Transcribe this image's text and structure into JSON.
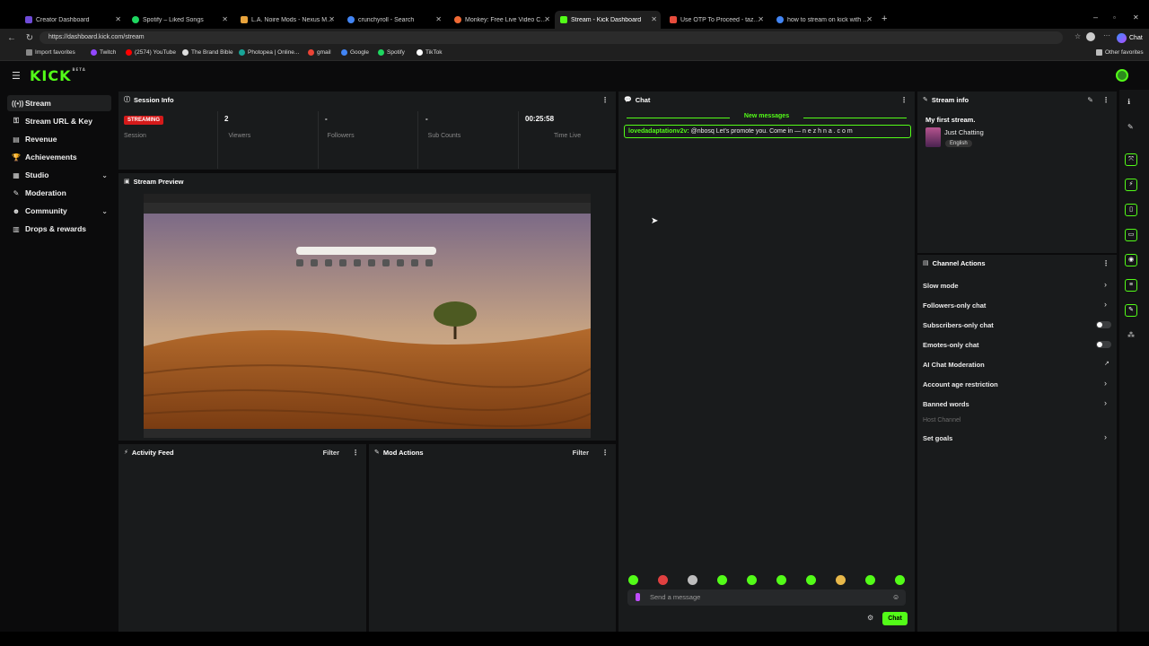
{
  "browser": {
    "tabs": [
      {
        "title": "Creator Dashboard",
        "color": "#6f4bd8"
      },
      {
        "title": "Spotify – Liked Songs",
        "color": "#1ed760"
      },
      {
        "title": "L.A. Noire Mods - Nexus Mods",
        "color": "#e8a33c"
      },
      {
        "title": "crunchyroll - Search",
        "color": "#4285f4"
      },
      {
        "title": "Monkey: Free Live Video Chat",
        "color": "#f06a35"
      },
      {
        "title": "Stream - Kick Dashboard",
        "color": "#53fc18"
      },
      {
        "title": "Use OTP To Proceed - tazwopo@gm",
        "color": "#e74c3c"
      },
      {
        "title": "how to stream on kick with obs - S",
        "color": "#4285f4"
      }
    ],
    "url": "https://dashboard.kick.com/stream",
    "bookmarks": [
      {
        "label": "Import favorites",
        "color": "#888888"
      },
      {
        "label": "Twitch",
        "color": "#9146ff"
      },
      {
        "label": "(2574) YouTube",
        "color": "#ff0000"
      },
      {
        "label": "The Brand Bible",
        "color": "#dddddd"
      },
      {
        "label": "Photopea | Online...",
        "color": "#18a497"
      },
      {
        "label": "gmail",
        "color": "#ea4335"
      },
      {
        "label": "Google",
        "color": "#4285f4"
      },
      {
        "label": "Spotify",
        "color": "#1ed760"
      },
      {
        "label": "TikTok",
        "color": "#ffffff"
      }
    ],
    "other_favorites": "Other favorites",
    "chat_label": "Chat"
  },
  "logo": "KICK",
  "logo_sup": "BETA",
  "sidebar": [
    {
      "label": "Stream",
      "icon": "stream-icon",
      "glyph": "((•))"
    },
    {
      "label": "Stream URL & Key",
      "icon": "key-icon",
      "glyph": "⚿"
    },
    {
      "label": "Revenue",
      "icon": "revenue-icon",
      "glyph": "▤"
    },
    {
      "label": "Achievements",
      "icon": "trophy-icon",
      "glyph": "🏆"
    },
    {
      "label": "Studio",
      "icon": "studio-icon",
      "glyph": "▦"
    },
    {
      "label": "Moderation",
      "icon": "wrench-icon",
      "glyph": "✎"
    },
    {
      "label": "Community",
      "icon": "community-icon",
      "glyph": "☻"
    },
    {
      "label": "Drops & rewards",
      "icon": "drops-icon",
      "glyph": "▥"
    }
  ],
  "session": {
    "title": "Session Info",
    "status": "STREAMING",
    "status_label": "Session",
    "viewers": "2",
    "viewers_label": "Viewers",
    "followers": "-",
    "followers_label": "Followers",
    "subs": "-",
    "subs_label": "Sub Counts",
    "time": "00:25:58",
    "time_label": "Time Live"
  },
  "preview": {
    "title": "Stream Preview"
  },
  "activity": {
    "title": "Activity Feed",
    "filter": "Filter"
  },
  "mod": {
    "title": "Mod Actions",
    "filter": "Filter"
  },
  "chat": {
    "title": "Chat",
    "new_messages": "New messages",
    "message_user": "lovedadaptationv2v:",
    "message_text": "@nbosq Let's promote you. Come in — n e z h n a . c o m",
    "placeholder": "Send a message",
    "send": "Chat"
  },
  "stream_info": {
    "title": "Stream info",
    "stream_title": "My first stream.",
    "category": "Just Chatting",
    "language": "English"
  },
  "channel_actions": {
    "title": "Channel Actions",
    "items": [
      {
        "label": "Slow mode",
        "kind": "chevron"
      },
      {
        "label": "Followers-only chat",
        "kind": "chevron"
      },
      {
        "label": "Subscribers-only chat",
        "kind": "toggle"
      },
      {
        "label": "Emotes-only chat",
        "kind": "toggle"
      },
      {
        "label": "AI Chat Moderation",
        "kind": "link"
      },
      {
        "label": "Account age restriction",
        "kind": "chevron"
      },
      {
        "label": "Banned words",
        "kind": "chevron"
      },
      {
        "label": "Host Channel",
        "kind": "disabled"
      },
      {
        "label": "Set goals",
        "kind": "chevron"
      }
    ]
  }
}
